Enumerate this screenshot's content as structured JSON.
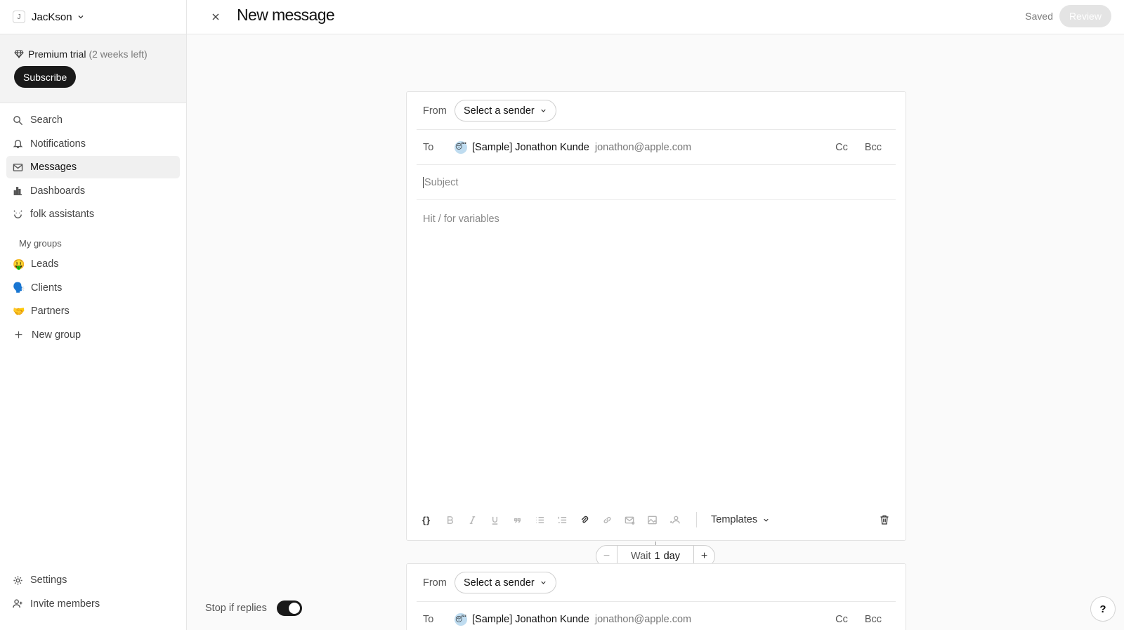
{
  "workspace": {
    "avatar_letter": "J",
    "name": "JacKson"
  },
  "trial": {
    "label": "Premium trial",
    "remaining": "(2 weeks left)",
    "subscribe_label": "Subscribe"
  },
  "nav": {
    "search": "Search",
    "notifications": "Notifications",
    "messages": "Messages",
    "dashboards": "Dashboards",
    "assistants": "folk assistants"
  },
  "groups": {
    "heading": "My groups",
    "items": [
      {
        "emoji": "🤑",
        "label": "Leads"
      },
      {
        "emoji": "🗣️",
        "label": "Clients"
      },
      {
        "emoji": "🤝",
        "label": "Partners"
      }
    ],
    "new_group": "New group"
  },
  "bottom_nav": {
    "settings": "Settings",
    "invite": "Invite members"
  },
  "header": {
    "title": "New message",
    "status": "Saved",
    "review_label": "Review"
  },
  "composer": {
    "from_label": "From",
    "sender_placeholder": "Select a sender",
    "to_label": "To",
    "recipient_emoji": "😴",
    "recipient_name": "[Sample] Jonathon Kunde",
    "recipient_email": "jonathon@apple.com",
    "cc_label": "Cc",
    "bcc_label": "Bcc",
    "subject_placeholder": "Subject",
    "body_placeholder": "Hit / for variables",
    "variables_glyph": "{}",
    "templates_label": "Templates"
  },
  "wait": {
    "prefix": "Wait",
    "value": "1",
    "unit": "day",
    "minus": "−",
    "plus": "+"
  },
  "stop_if_replies": {
    "label": "Stop if replies",
    "enabled": true
  },
  "help_label": "?"
}
